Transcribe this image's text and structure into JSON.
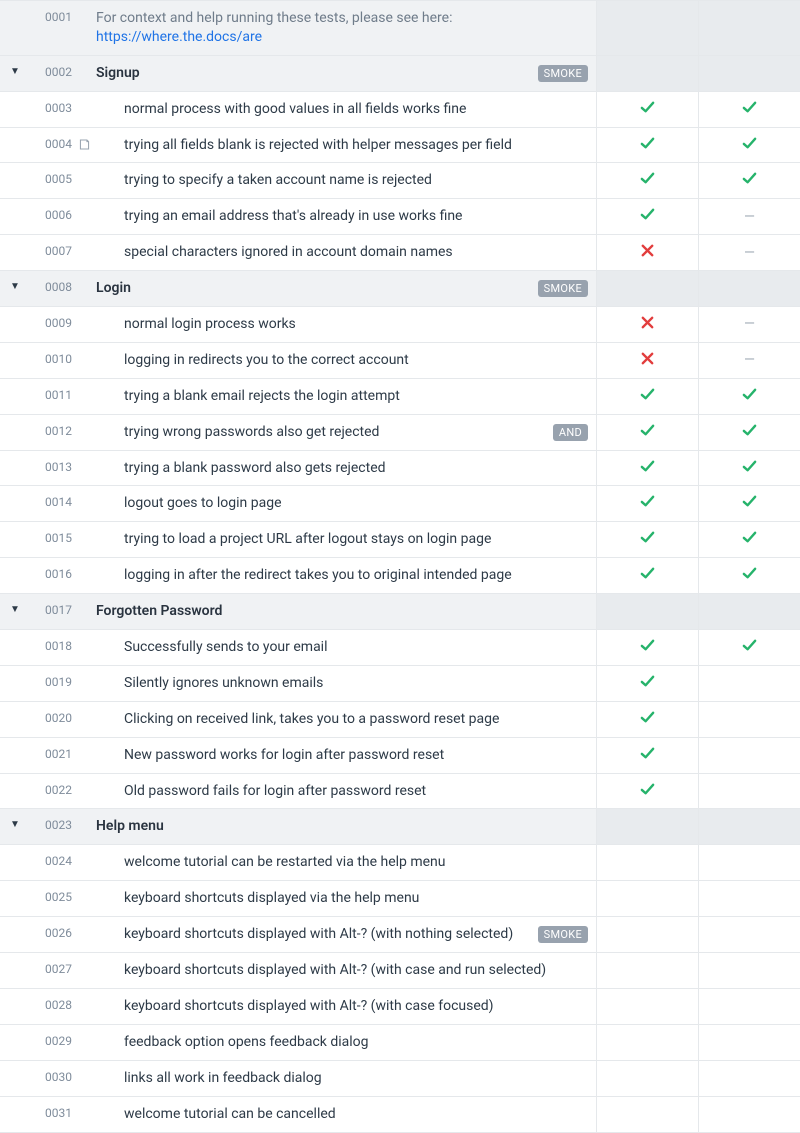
{
  "context": {
    "id": "0001",
    "text": "For context and help running these tests, please see here:",
    "link": "https://where.the.docs/are"
  },
  "badges": {
    "smoke": "SMOKE",
    "and": "AND"
  },
  "groups": [
    {
      "id": "0002",
      "title": "Signup",
      "badge": "smoke",
      "rows": [
        {
          "id": "0003",
          "text": "normal process with good values in all fields works fine",
          "a": "pass",
          "b": "pass"
        },
        {
          "id": "0004",
          "text": "trying all fields blank is rejected with helper messages per field",
          "note": true,
          "a": "pass",
          "b": "pass"
        },
        {
          "id": "0005",
          "text": "trying to specify a taken account name is rejected",
          "a": "pass",
          "b": "pass"
        },
        {
          "id": "0006",
          "text": "trying an email address that's already in use works fine",
          "a": "pass",
          "b": "skip"
        },
        {
          "id": "0007",
          "text": "special characters ignored in account domain names",
          "a": "fail",
          "b": "skip"
        }
      ]
    },
    {
      "id": "0008",
      "title": "Login",
      "badge": "smoke",
      "rows": [
        {
          "id": "0009",
          "text": "normal login process works",
          "a": "fail",
          "b": "skip"
        },
        {
          "id": "0010",
          "text": "logging in redirects you to the correct account",
          "a": "fail",
          "b": "skip"
        },
        {
          "id": "0011",
          "text": "trying a blank email rejects the login attempt",
          "a": "pass",
          "b": "pass"
        },
        {
          "id": "0012",
          "text": "trying wrong passwords also get rejected",
          "badge": "and",
          "a": "pass",
          "b": "pass"
        },
        {
          "id": "0013",
          "text": "trying a blank password also gets rejected",
          "a": "pass",
          "b": "pass"
        },
        {
          "id": "0014",
          "text": "logout goes to login page",
          "a": "pass",
          "b": "pass"
        },
        {
          "id": "0015",
          "text": "trying to load a project URL after logout stays on login page",
          "a": "pass",
          "b": "pass"
        },
        {
          "id": "0016",
          "text": "logging in after the redirect takes you to original intended page",
          "a": "pass",
          "b": "pass"
        }
      ]
    },
    {
      "id": "0017",
      "title": "Forgotten Password",
      "rows": [
        {
          "id": "0018",
          "text": "Successfully sends to your email",
          "a": "pass",
          "b": "pass"
        },
        {
          "id": "0019",
          "text": "Silently ignores unknown emails",
          "a": "pass",
          "b": ""
        },
        {
          "id": "0020",
          "text": "Clicking on received link, takes you to a password reset page",
          "a": "pass",
          "b": ""
        },
        {
          "id": "0021",
          "text": "New password works for login after password reset",
          "a": "pass",
          "b": ""
        },
        {
          "id": "0022",
          "text": "Old password fails for login after password reset",
          "a": "pass",
          "b": ""
        }
      ]
    },
    {
      "id": "0023",
      "title": "Help menu",
      "rows": [
        {
          "id": "0024",
          "text": "welcome tutorial can be restarted via the help menu",
          "a": "",
          "b": ""
        },
        {
          "id": "0025",
          "text": "keyboard shortcuts displayed via the help menu",
          "a": "",
          "b": ""
        },
        {
          "id": "0026",
          "text": "keyboard shortcuts displayed with Alt-? (with nothing selected)",
          "badge": "smoke",
          "a": "",
          "b": ""
        },
        {
          "id": "0027",
          "text": "keyboard shortcuts displayed with Alt-? (with case and run selected)",
          "a": "",
          "b": ""
        },
        {
          "id": "0028",
          "text": "keyboard shortcuts displayed with Alt-? (with case focused)",
          "a": "",
          "b": ""
        },
        {
          "id": "0029",
          "text": "feedback option opens feedback dialog",
          "a": "",
          "b": ""
        },
        {
          "id": "0030",
          "text": "links all work in feedback dialog",
          "a": "",
          "b": ""
        },
        {
          "id": "0031",
          "text": "welcome tutorial can be cancelled",
          "a": "",
          "b": ""
        }
      ]
    }
  ]
}
